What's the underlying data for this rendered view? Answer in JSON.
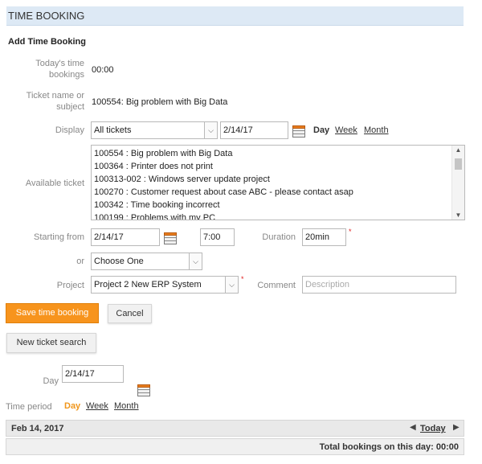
{
  "header": {
    "title": "TIME BOOKING"
  },
  "form": {
    "section_title": "Add Time Booking",
    "todays_bookings": {
      "label_line1": "Today's time",
      "label_line2": "bookings",
      "value": "00:00"
    },
    "ticket": {
      "label_line1": "Ticket name or",
      "label_line2": "subject",
      "value": "100554: Big problem with Big Data"
    },
    "display": {
      "label": "Display",
      "select_value": "All tickets",
      "date_value": "2/14/17",
      "day_label": "Day",
      "week_label": "Week",
      "month_label": "Month"
    },
    "available": {
      "label": "Available ticket",
      "items": [
        "100554 : Big problem with Big Data",
        "100364 : Printer does not print",
        "100313-002 : Windows server update project",
        "100270 : Customer request about case ABC - please contact asap",
        "100342 : Time booking incorrect",
        "100199 : Problems with my PC"
      ]
    },
    "starting": {
      "label": "Starting from",
      "date": "2/14/17",
      "time": "7:00",
      "duration_label": "Duration",
      "duration": "20min"
    },
    "or": {
      "label": "or",
      "select_value": "Choose One"
    },
    "project": {
      "label": "Project",
      "select_value": "Project 2 New ERP System",
      "comment_label": "Comment",
      "comment_placeholder": "Description"
    },
    "required_mark": "*"
  },
  "buttons": {
    "save": "Save time booking",
    "cancel": "Cancel",
    "new_search": "New ticket search"
  },
  "day_filter": {
    "label": "Day",
    "value": "2/14/17"
  },
  "time_period": {
    "label": "Time period",
    "day": "Day",
    "week": "Week",
    "month": "Month"
  },
  "table": {
    "date": "Feb 14, 2017",
    "today_label": "Today",
    "total_label": "Total bookings on this day: 00:00"
  },
  "colors": {
    "accent": "#f7941d",
    "header_bg": "#dde9f5"
  }
}
